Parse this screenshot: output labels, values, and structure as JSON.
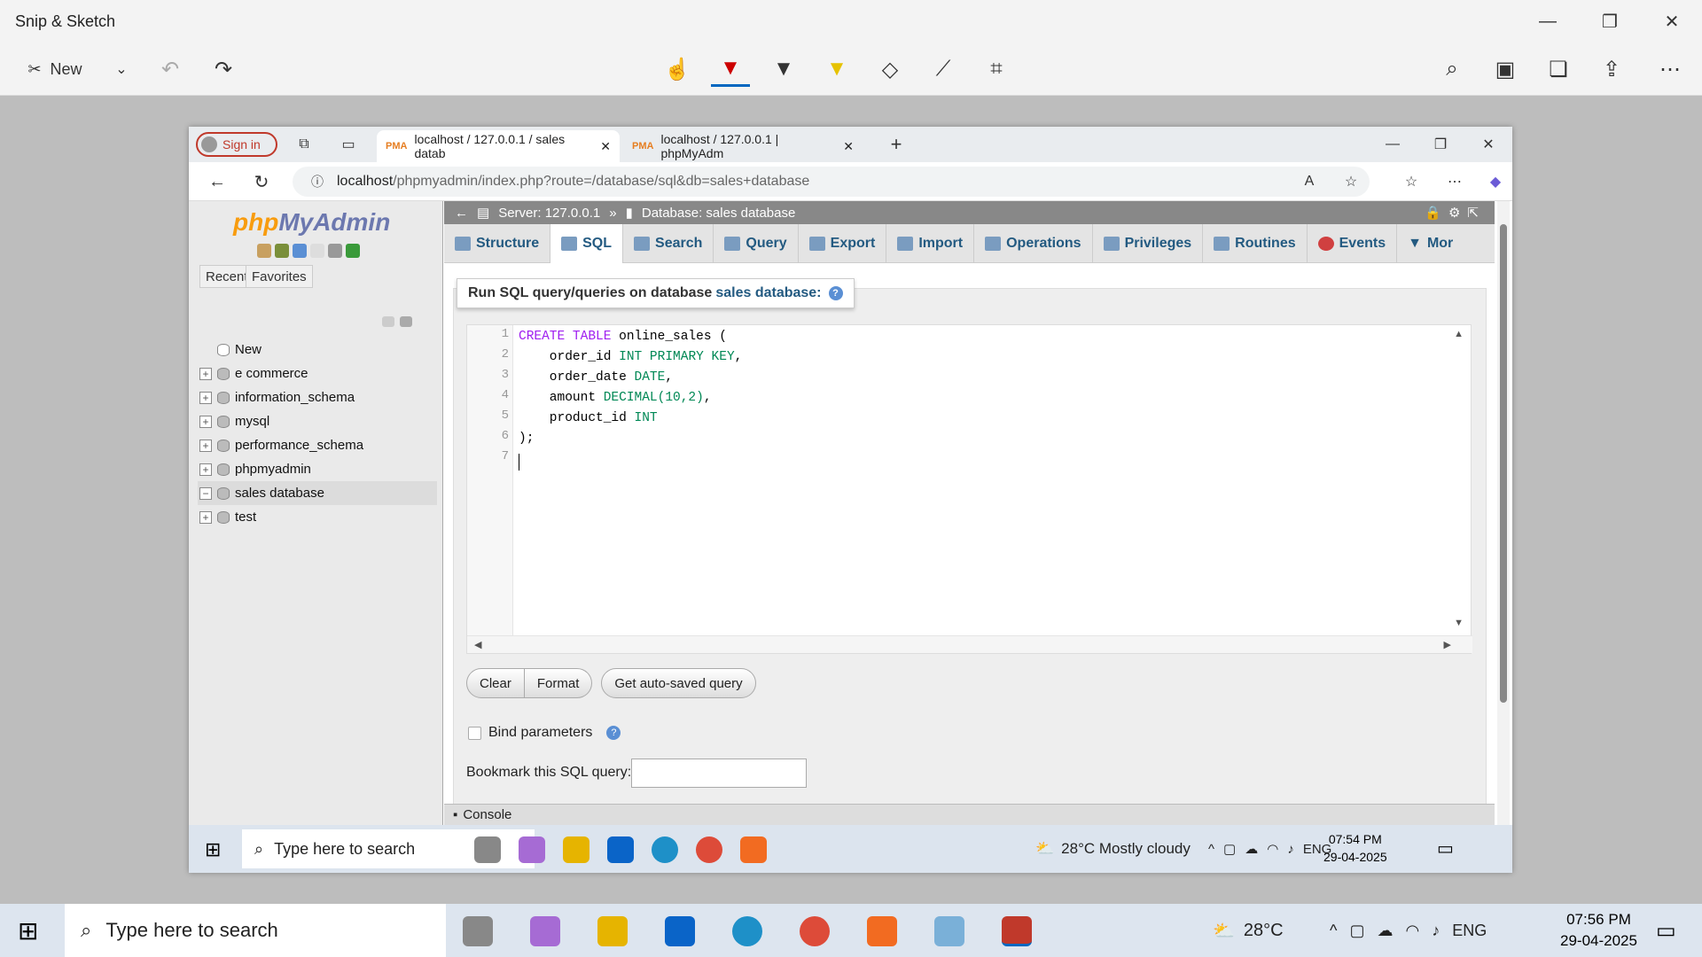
{
  "snip": {
    "title": "Snip & Sketch",
    "new_label": "New"
  },
  "browser": {
    "signin": "Sign in",
    "tabs": [
      {
        "label": "localhost / 127.0.0.1 / sales datab",
        "favicon": "PMA"
      },
      {
        "label": "localhost / 127.0.0.1 | phpMyAdm",
        "favicon": "PMA"
      }
    ],
    "url_host": "localhost",
    "url_path": "/phpmyadmin/index.php?route=/database/sql&db=sales+database"
  },
  "pma": {
    "logo_php": "php",
    "logo_myadmin": "MyAdmin",
    "recent": "Recent",
    "favorites": "Favorites",
    "tree": [
      {
        "label": "New",
        "expand": ""
      },
      {
        "label": "e commerce",
        "expand": "+"
      },
      {
        "label": "information_schema",
        "expand": "+"
      },
      {
        "label": "mysql",
        "expand": "+"
      },
      {
        "label": "performance_schema",
        "expand": "+"
      },
      {
        "label": "phpmyadmin",
        "expand": "+"
      },
      {
        "label": "sales database",
        "expand": "−"
      },
      {
        "label": "test",
        "expand": "+"
      }
    ],
    "breadcrumb_server": "Server: 127.0.0.1",
    "breadcrumb_sep": "»",
    "breadcrumb_db": "Database: sales database",
    "menu": [
      "Structure",
      "SQL",
      "Search",
      "Query",
      "Export",
      "Import",
      "Operations",
      "Privileges",
      "Routines",
      "Events",
      "Mor"
    ],
    "run_title": "Run SQL query/queries on database",
    "run_db": "sales database:",
    "help_glyph": "?",
    "line_numbers": [
      "1",
      "2",
      "3",
      "4",
      "5",
      "6",
      "7"
    ],
    "code": {
      "l1_kw": "CREATE TABLE",
      "l1_rest": " online_sales (",
      "l2_id": "    order_id ",
      "l2_kw": "INT PRIMARY KEY",
      "l2_end": ",",
      "l3_id": "    order_date ",
      "l3_kw": "DATE",
      "l3_end": ",",
      "l4_id": "    amount ",
      "l4_kw": "DECIMAL(10,2)",
      "l4_end": ",",
      "l5_id": "    product_id ",
      "l5_kw": "INT",
      "l6": ");"
    },
    "btn_clear": "Clear",
    "btn_format": "Format",
    "btn_autosaved": "Get auto-saved query",
    "bind_params": "Bind parameters",
    "bookmark_label": "Bookmark this SQL query:",
    "console": "Console"
  },
  "inner_taskbar": {
    "search": "Type here to search",
    "weather": "28°C  Mostly cloudy",
    "lang": "ENG",
    "time": "07:54 PM",
    "date": "29-04-2025"
  },
  "outer_taskbar": {
    "search": "Type here to search",
    "weather": "28°C",
    "lang": "ENG",
    "time": "07:56 PM",
    "date": "29-04-2025"
  }
}
